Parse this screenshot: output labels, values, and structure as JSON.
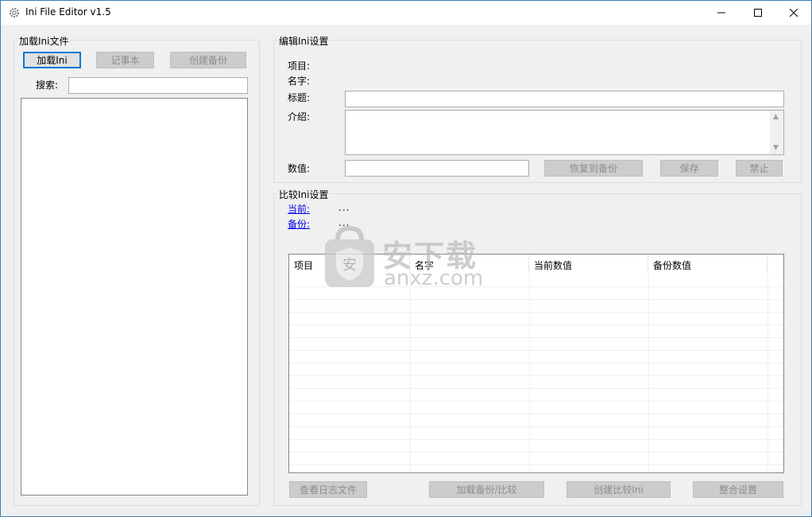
{
  "app": {
    "title": "Ini File Editor v1.5"
  },
  "left_panel": {
    "group_title": "加载Ini文件",
    "load_button": "加载Ini",
    "notepad_button": "记事本",
    "create_backup_button": "创建备份",
    "search_label": "搜索:",
    "search_value": ""
  },
  "edit_panel": {
    "group_title": "编辑Ini设置",
    "item_label": "项目:",
    "name_label": "名字:",
    "title_label": "标题:",
    "title_value": "",
    "intro_label": "介绍:",
    "intro_value": "",
    "value_label": "数值:",
    "value_value": "",
    "restore_button": "恢复到备份",
    "save_button": "保存",
    "disable_button": "禁止"
  },
  "compare_panel": {
    "group_title": "比较Ini设置",
    "current_link": "当前:",
    "current_value": "...",
    "backup_link": "备份:",
    "backup_value": "...",
    "columns": [
      "项目",
      "名字",
      "当前数值",
      "备份数值"
    ],
    "rows": [],
    "view_log_button": "查看日志文件",
    "load_backup_compare_button": "加载备份/比较",
    "create_compare_button": "创建比较Ini",
    "merge_button": "整合设置"
  },
  "watermark": {
    "cn_text": "安下载",
    "url_text": "anxz.com"
  },
  "colors": {
    "accent": "#0078d7",
    "window_border": "#3c7fb1",
    "link": "#0000ee",
    "disabled_button": "#cccccc"
  }
}
